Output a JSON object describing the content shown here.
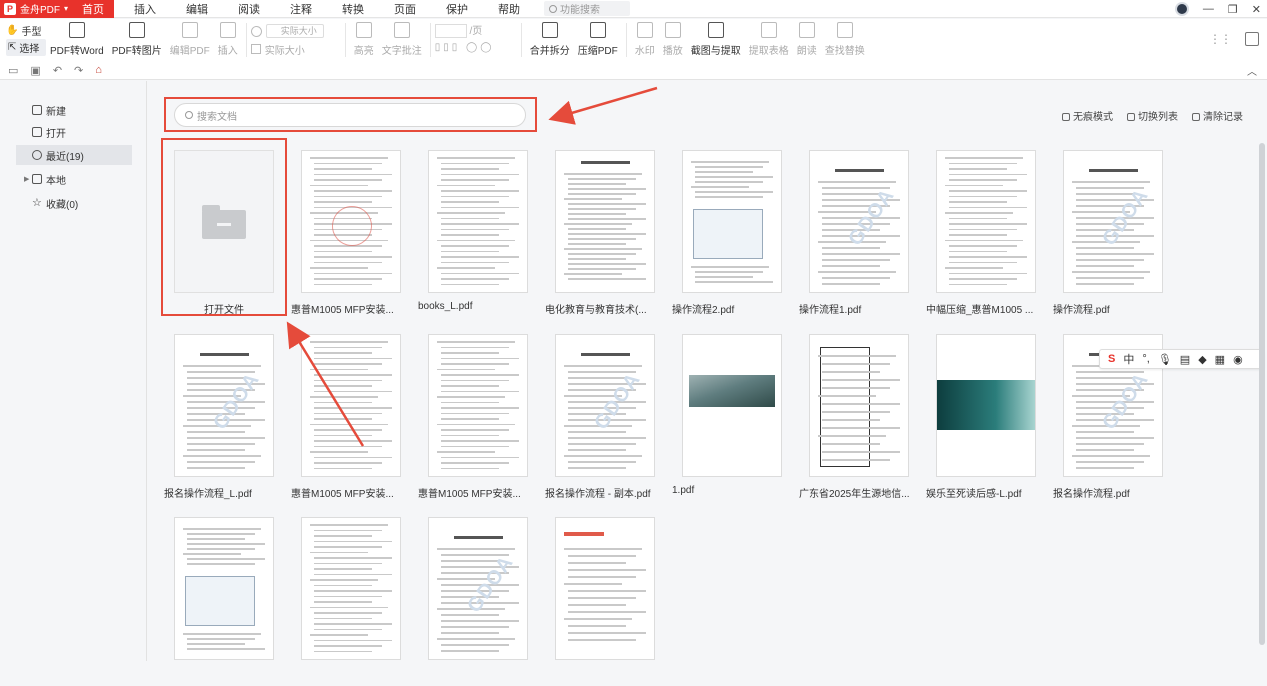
{
  "app": {
    "name": "金舟PDF",
    "menu_tabs": [
      "首页",
      "插入",
      "编辑",
      "阅读",
      "注释",
      "转换",
      "页面",
      "保护",
      "帮助"
    ],
    "active_tab": "首页",
    "menu_search_placeholder": "功能搜索"
  },
  "toolbar": {
    "hand_tool": "手型",
    "select_tool": "选择",
    "buttons": [
      {
        "label": "PDF转Word",
        "enabled": true,
        "icon": "word-icon"
      },
      {
        "label": "PDF转图片",
        "enabled": true,
        "icon": "image-icon"
      },
      {
        "label": "编辑PDF",
        "enabled": false,
        "icon": "edit-icon"
      },
      {
        "label": "插入",
        "enabled": false,
        "icon": "insert-icon"
      }
    ],
    "zoom_value": "实际大小",
    "zoom_label": "实际大小",
    "highlight": "高亮",
    "text_note": "文字批注",
    "page_label": "/页",
    "buttons2": [
      {
        "label": "合并拆分",
        "enabled": true,
        "icon": "merge-icon"
      },
      {
        "label": "压缩PDF",
        "enabled": true,
        "icon": "compress-icon"
      },
      {
        "label": "水印",
        "enabled": false,
        "icon": "watermark-icon"
      },
      {
        "label": "播放",
        "enabled": false,
        "icon": "play-icon"
      },
      {
        "label": "截图与提取",
        "enabled": true,
        "icon": "screenshot-icon"
      },
      {
        "label": "提取表格",
        "enabled": false,
        "icon": "table-extract-icon"
      },
      {
        "label": "朗读",
        "enabled": false,
        "icon": "read-aloud-icon"
      },
      {
        "label": "查找替换",
        "enabled": false,
        "icon": "find-replace-icon"
      }
    ]
  },
  "sidebar": {
    "items": [
      {
        "label": "新建",
        "icon": "new-file-icon"
      },
      {
        "label": "打开",
        "icon": "open-file-icon"
      },
      {
        "label": "最近(19)",
        "icon": "clock-icon",
        "active": true
      },
      {
        "label": "本地",
        "icon": "computer-icon"
      },
      {
        "label": "收藏(0)",
        "icon": "star-icon"
      }
    ]
  },
  "content": {
    "search_placeholder": "搜索文档",
    "header_links": [
      "无痕模式",
      "切换列表",
      "清除记录"
    ],
    "open_file_label": "打开文件",
    "files": [
      {
        "name": "惠普M1005 MFP安装...",
        "kind": "doc-stamp"
      },
      {
        "name": "books_L.pdf",
        "kind": "doc"
      },
      {
        "name": "电化教育与教育技术(...",
        "kind": "text"
      },
      {
        "name": "操作流程2.pdf",
        "kind": "screens"
      },
      {
        "name": "操作流程1.pdf",
        "kind": "toc"
      },
      {
        "name": "中幅压缩_惠普M1005 ...",
        "kind": "doc"
      },
      {
        "name": "操作流程.pdf",
        "kind": "toc"
      },
      {
        "name": "报名操作流程_L.pdf",
        "kind": "toc"
      },
      {
        "name": "惠普M1005 MFP安装...",
        "kind": "doc"
      },
      {
        "name": "惠普M1005 MFP安装...",
        "kind": "doc"
      },
      {
        "name": "报名操作流程 - 副本.pdf",
        "kind": "toc"
      },
      {
        "name": "1.pdf",
        "kind": "photo"
      },
      {
        "name": "广东省2025年生源地信...",
        "kind": "table"
      },
      {
        "name": "娱乐至死读后感-L.pdf",
        "kind": "teal"
      },
      {
        "name": "报名操作流程.pdf",
        "kind": "toc"
      },
      {
        "name": "",
        "kind": "screens"
      },
      {
        "name": "",
        "kind": "doc"
      },
      {
        "name": "",
        "kind": "toc"
      },
      {
        "name": "",
        "kind": "promo"
      }
    ],
    "watermark_text": "GDOA"
  },
  "ime": {
    "items": [
      "S",
      "中",
      "°,",
      "🎤",
      "⌨",
      "👕",
      "🎨",
      "▦",
      "🐟"
    ]
  },
  "colors": {
    "brand": "#e8322b",
    "highlight_box": "#e54b3b"
  }
}
